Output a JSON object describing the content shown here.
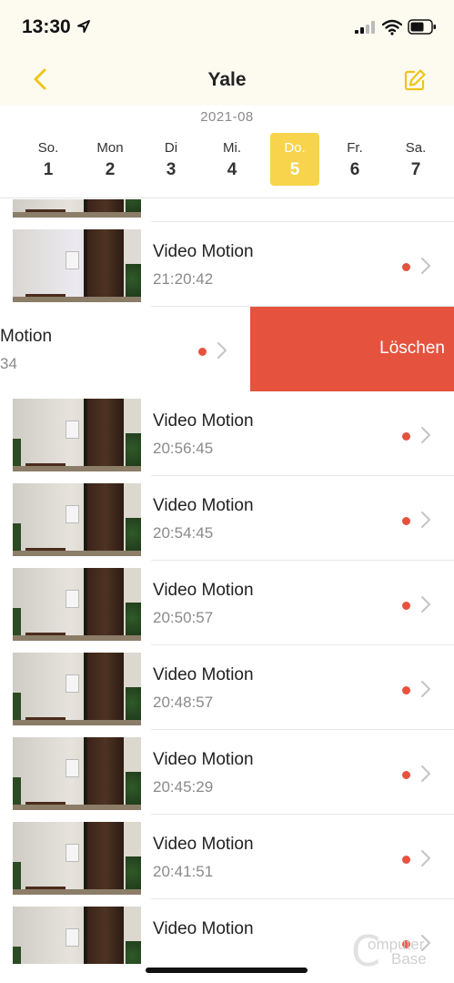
{
  "status_bar": {
    "time": "13:30"
  },
  "nav": {
    "title": "Yale"
  },
  "date_strip": {
    "month": "2021-08",
    "days": [
      {
        "name": "So.",
        "num": "1"
      },
      {
        "name": "Mon",
        "num": "2"
      },
      {
        "name": "Di",
        "num": "3"
      },
      {
        "name": "Mi.",
        "num": "4"
      },
      {
        "name": "Do.",
        "num": "5"
      },
      {
        "name": "Fr.",
        "num": "6"
      },
      {
        "name": "Sa.",
        "num": "7"
      }
    ],
    "selected_day": "5"
  },
  "events": [
    {
      "title": "Video Motion",
      "time": "21:20:42"
    },
    {
      "title": "Video Motion",
      "time": "20:56:45"
    },
    {
      "title": "Video Motion",
      "time": "20:54:45"
    },
    {
      "title": "Video Motion",
      "time": "20:50:57"
    },
    {
      "title": "Video Motion",
      "time": "20:48:57"
    },
    {
      "title": "Video Motion",
      "time": "20:45:29"
    },
    {
      "title": "Video Motion",
      "time": "20:41:51"
    },
    {
      "title": "Video Motion",
      "time": ""
    }
  ],
  "swiped_row": {
    "title": "Motion",
    "time": "34",
    "delete_label": "Löschen"
  },
  "watermark": {
    "line1": "omputer",
    "line2": "Base"
  },
  "colors": {
    "accent": "#f7d44c",
    "unread_dot": "#e5533f",
    "delete": "#e5533f"
  }
}
